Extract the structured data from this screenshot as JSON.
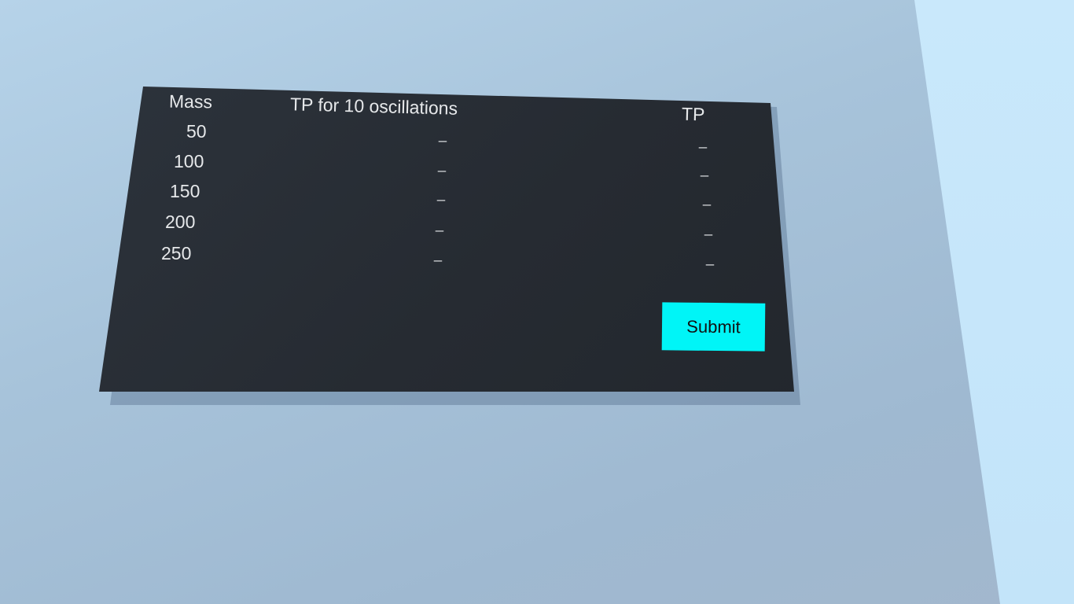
{
  "table": {
    "headers": {
      "mass": "Mass",
      "tp10": "TP for 10 oscillations",
      "tp": "TP"
    },
    "rows": [
      {
        "mass": "50",
        "tp10": "_",
        "tp": "_"
      },
      {
        "mass": "100",
        "tp10": "_",
        "tp": "_"
      },
      {
        "mass": "150",
        "tp10": "_",
        "tp": "_"
      },
      {
        "mass": "200",
        "tp10": "_",
        "tp": "_"
      },
      {
        "mass": "250",
        "tp10": "_",
        "tp": "_"
      }
    ]
  },
  "actions": {
    "submit_label": "Submit"
  },
  "colors": {
    "board": "#262b32",
    "submit_bg": "#00f5f7",
    "background": "#a7c3da",
    "wall": "#c9e8fb"
  }
}
